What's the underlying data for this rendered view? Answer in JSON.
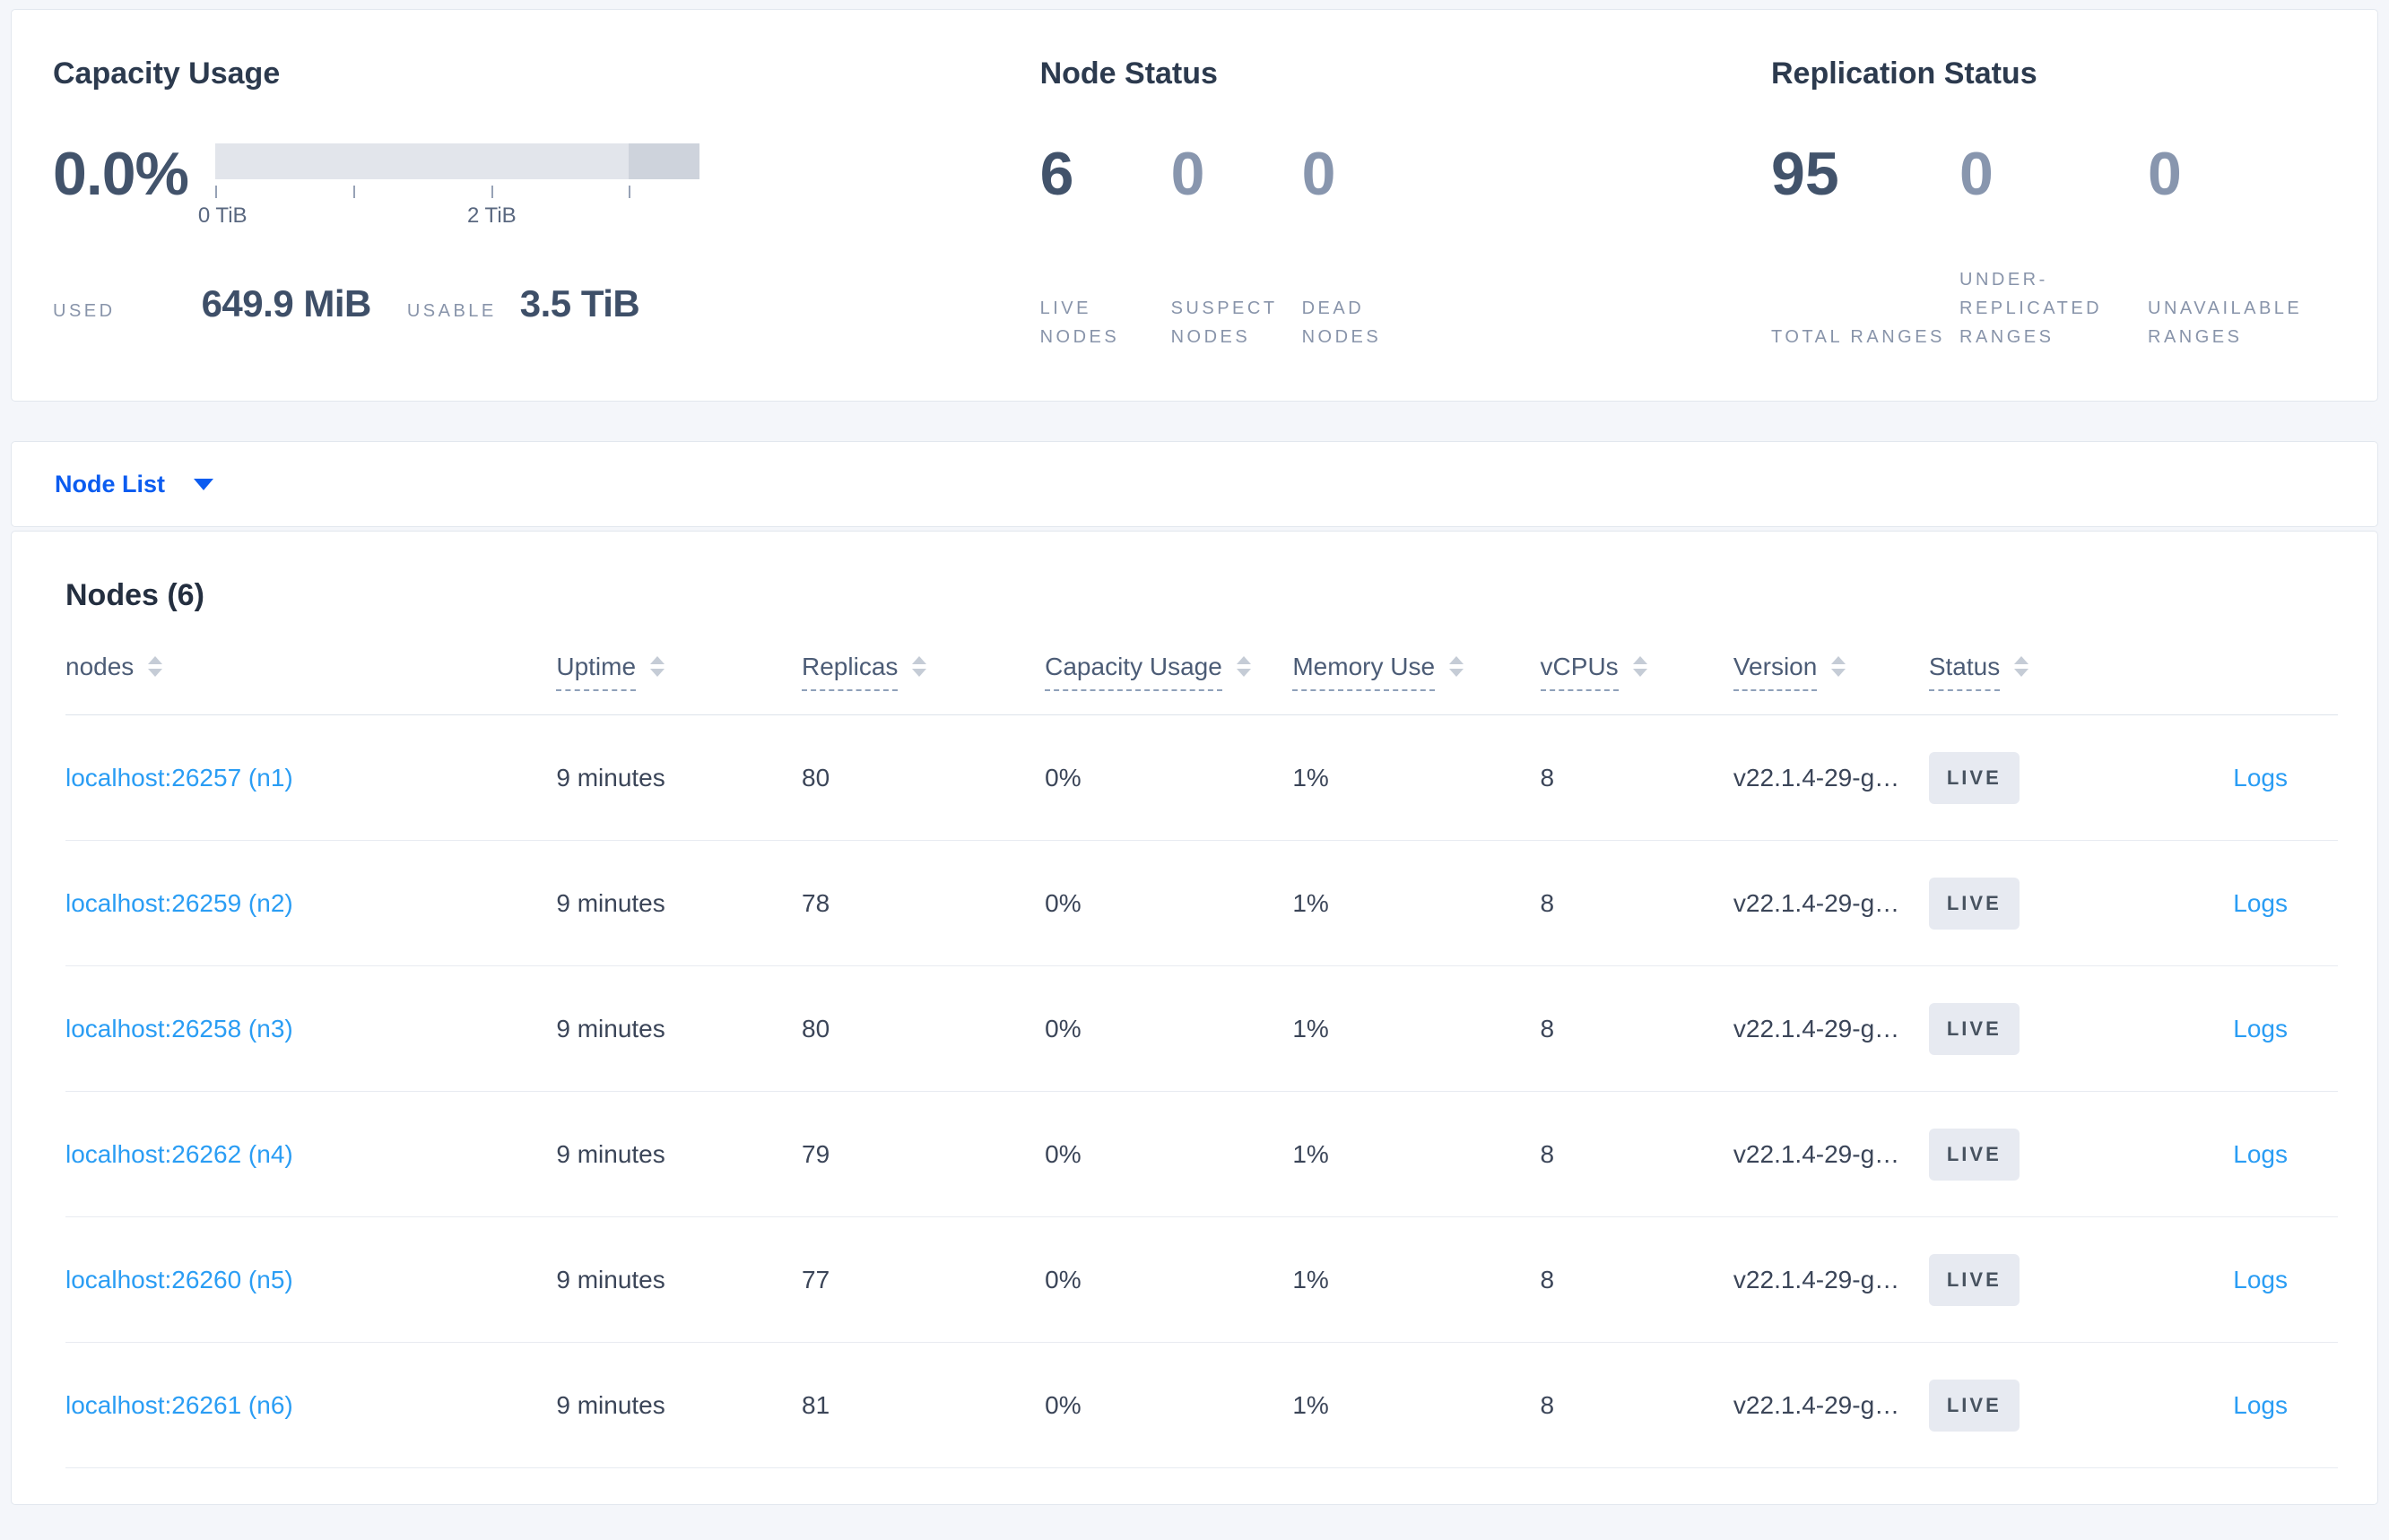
{
  "summary": {
    "capacity": {
      "title": "Capacity Usage",
      "percent": "0.0%",
      "tick_labels": [
        "0 TiB",
        "2 TiB"
      ],
      "used_label": "USED",
      "used_value": "649.9 MiB",
      "usable_label": "USABLE",
      "usable_value": "3.5 TiB"
    },
    "node_status": {
      "title": "Node Status",
      "stats": [
        {
          "value": "6",
          "label": "LIVE NODES"
        },
        {
          "value": "0",
          "label": "SUSPECT NODES"
        },
        {
          "value": "0",
          "label": "DEAD NODES"
        }
      ]
    },
    "replication": {
      "title": "Replication Status",
      "stats": [
        {
          "value": "95",
          "label": "TOTAL RANGES"
        },
        {
          "value": "0",
          "label": "UNDER-REPLICATED RANGES"
        },
        {
          "value": "0",
          "label": "UNAVAILABLE RANGES"
        }
      ]
    }
  },
  "view_selector": {
    "label": "Node List"
  },
  "nodes_section": {
    "title": "Nodes (6)",
    "table": {
      "columns": [
        {
          "label": "nodes"
        },
        {
          "label": "Uptime"
        },
        {
          "label": "Replicas"
        },
        {
          "label": "Capacity Usage"
        },
        {
          "label": "Memory Use"
        },
        {
          "label": "vCPUs"
        },
        {
          "label": "Version"
        },
        {
          "label": "Status"
        },
        {
          "label": ""
        }
      ],
      "rows": [
        {
          "node": "localhost:26257 (n1)",
          "uptime": "9 minutes",
          "replicas": "80",
          "capacity": "0%",
          "memory": "1%",
          "vcpus": "8",
          "version": "v22.1.4-29-g…",
          "status": "LIVE",
          "logs": "Logs"
        },
        {
          "node": "localhost:26259 (n2)",
          "uptime": "9 minutes",
          "replicas": "78",
          "capacity": "0%",
          "memory": "1%",
          "vcpus": "8",
          "version": "v22.1.4-29-g…",
          "status": "LIVE",
          "logs": "Logs"
        },
        {
          "node": "localhost:26258 (n3)",
          "uptime": "9 minutes",
          "replicas": "80",
          "capacity": "0%",
          "memory": "1%",
          "vcpus": "8",
          "version": "v22.1.4-29-g…",
          "status": "LIVE",
          "logs": "Logs"
        },
        {
          "node": "localhost:26262 (n4)",
          "uptime": "9 minutes",
          "replicas": "79",
          "capacity": "0%",
          "memory": "1%",
          "vcpus": "8",
          "version": "v22.1.4-29-g…",
          "status": "LIVE",
          "logs": "Logs"
        },
        {
          "node": "localhost:26260 (n5)",
          "uptime": "9 minutes",
          "replicas": "77",
          "capacity": "0%",
          "memory": "1%",
          "vcpus": "8",
          "version": "v22.1.4-29-g…",
          "status": "LIVE",
          "logs": "Logs"
        },
        {
          "node": "localhost:26261 (n6)",
          "uptime": "9 minutes",
          "replicas": "81",
          "capacity": "0%",
          "memory": "1%",
          "vcpus": "8",
          "version": "v22.1.4-29-g…",
          "status": "LIVE",
          "logs": "Logs"
        }
      ]
    }
  },
  "colors": {
    "link_blue": "#2a9df4",
    "selector_blue": "#0b5cf0",
    "badge_bg": "#e7eaf1",
    "bar_light": "#e2e5eb",
    "bar_dark": "#ced3dc",
    "page_bg": "#f4f6fa"
  }
}
